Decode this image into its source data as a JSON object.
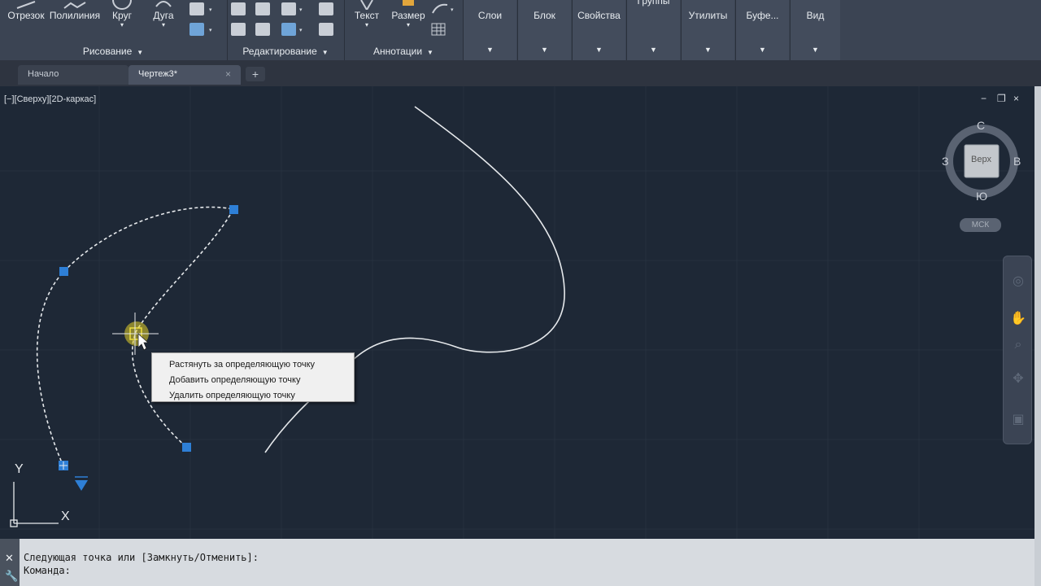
{
  "ribbon": {
    "draw": {
      "tools": [
        "Отрезок",
        "Полилиния",
        "Круг",
        "Дуга"
      ],
      "title": "Рисование"
    },
    "edit": {
      "title": "Редактирование"
    },
    "annot": {
      "tools": [
        "Текст",
        "Размер"
      ],
      "title": "Аннотации"
    },
    "panels": [
      "Слои",
      "Блок",
      "Свойства",
      "Группы",
      "Утилиты",
      "Буфе...",
      "Вид"
    ]
  },
  "tabs": [
    {
      "label": "Начало"
    },
    {
      "label": "Чертеж3*"
    }
  ],
  "tab_add": "+",
  "viewport": {
    "label": "[−][Сверху][2D-каркас]",
    "controls": [
      "−",
      "❐",
      "×"
    ]
  },
  "viewcube": {
    "face": "Верх",
    "north": "С",
    "south": "Ю",
    "east": "В",
    "west": "З",
    "ucs": "МСК"
  },
  "ucs_axes": {
    "x": "X",
    "y": "Y"
  },
  "context_menu": {
    "items": [
      "Растянуть за определяющую точку",
      "Добавить определяющую точку",
      "Удалить определяющую точку"
    ]
  },
  "command": {
    "history": "Следующая точка или [Замкнуть/Отменить]:",
    "prompt": "Команда:"
  },
  "colors": {
    "canvas": "#1e2836",
    "grip": "#2e7fd6",
    "curve": "#e6e9ec",
    "ribbon": "#3b4453"
  }
}
